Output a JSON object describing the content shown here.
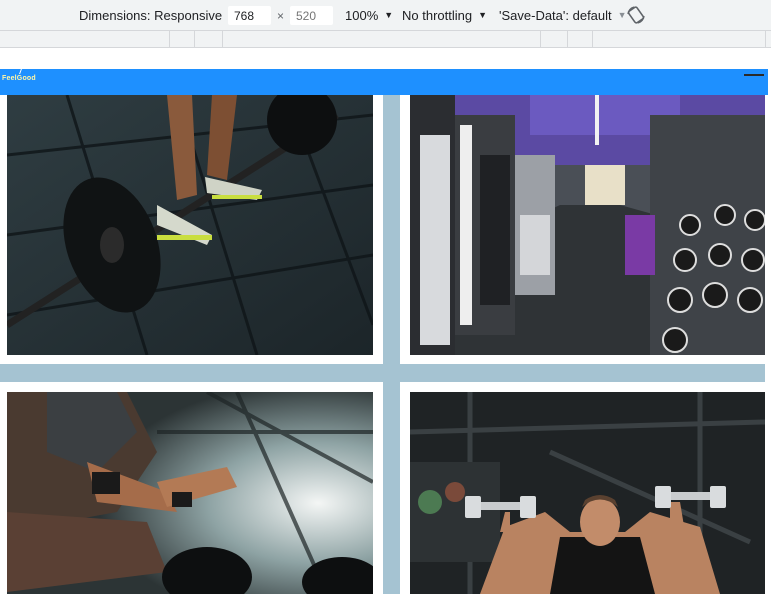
{
  "devtools": {
    "dimensions_label": "Dimensions: Responsive",
    "width_value": "768",
    "times_sign": "×",
    "height_placeholder": "520",
    "zoom_label": "100%",
    "throttling_label": "No throttling",
    "save_data_label": "'Save-Data': default",
    "rotate_icon": "rotate-icon"
  },
  "page": {
    "brand": "FeelGood",
    "colors": {
      "navbar": "#1e90ff",
      "grid_background": "#a5c3d2"
    },
    "gallery": [
      {
        "alt": "Barbell deadlift close-up"
      },
      {
        "alt": "Gym interior with machines and dumbbell racks"
      },
      {
        "alt": "Athlete resting by barbell"
      },
      {
        "alt": "Man pressing dumbbells overhead"
      }
    ]
  }
}
